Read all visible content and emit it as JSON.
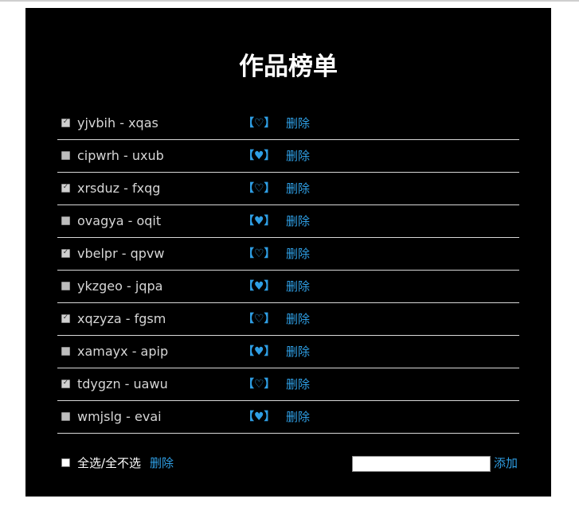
{
  "title": "作品榜单",
  "items": [
    {
      "name": "yjvbih - xqas",
      "checked": true,
      "heart": "【♡】",
      "delete_label": "删除"
    },
    {
      "name": "cipwrh - uxub",
      "checked": false,
      "heart": "【♥】",
      "delete_label": "删除"
    },
    {
      "name": "xrsduz - fxqg",
      "checked": true,
      "heart": "【♡】",
      "delete_label": "删除"
    },
    {
      "name": "ovagya - oqit",
      "checked": false,
      "heart": "【♥】",
      "delete_label": "删除"
    },
    {
      "name": "vbelpr - qpvw",
      "checked": true,
      "heart": "【♡】",
      "delete_label": "删除"
    },
    {
      "name": "ykzgeo - jqpa",
      "checked": false,
      "heart": "【♥】",
      "delete_label": "删除"
    },
    {
      "name": "xqzyza - fgsm",
      "checked": true,
      "heart": "【♡】",
      "delete_label": "删除"
    },
    {
      "name": "xamayx - apip",
      "checked": false,
      "heart": "【♥】",
      "delete_label": "删除"
    },
    {
      "name": "tdygzn - uawu",
      "checked": true,
      "heart": "【♡】",
      "delete_label": "删除"
    },
    {
      "name": "wmjslg - evai",
      "checked": false,
      "heart": "【♥】",
      "delete_label": "删除"
    }
  ],
  "footer": {
    "select_all_label": "全选/全不选",
    "select_all_checked": false,
    "delete_label": "删除",
    "add_input_value": "",
    "add_label": "添加"
  },
  "colors": {
    "background": "#000000",
    "accent": "#2f9fe5",
    "divider": "#d8d8d8"
  }
}
